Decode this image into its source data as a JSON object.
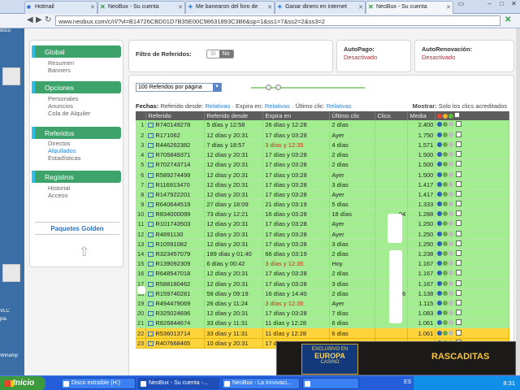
{
  "tabs": [
    {
      "label": "Hotmail",
      "icon": "hotmail-icon"
    },
    {
      "label": "NeoBux - Su cuenta",
      "icon": "neobux-icon"
    },
    {
      "label": "Me banearon del foro de",
      "icon": "forum-icon"
    },
    {
      "label": "Ganar dinero en internet",
      "icon": "forum-icon"
    },
    {
      "label": "NeoBux - Su cuenta",
      "icon": "neobux-icon"
    }
  ],
  "address": "www.neobux.com/c/rl/?vl=B14726CBD01D7B35E00C98631893C3B6&sp=1&ss1=7&ss2=2&ss3=2",
  "desktop": [
    "docu",
    "VLC",
    "pla",
    "Winamp"
  ],
  "menu": {
    "global": {
      "title": "Global",
      "items": [
        "Resumen",
        "Banners"
      ]
    },
    "opciones": {
      "title": "Opciones",
      "items": [
        "Personales",
        "Anuncios",
        "Cola de Alquiler"
      ]
    },
    "referidos": {
      "title": "Referidos",
      "items": [
        "Directos",
        "Alquilados",
        "Estadísticas"
      ]
    },
    "registros": {
      "title": "Registros",
      "items": [
        "Historial",
        "Acceso"
      ]
    },
    "golden": "Paquetes Golden"
  },
  "filter": {
    "label": "Filtro de Referidos:",
    "yes": "Sí",
    "no": "No"
  },
  "autopago": {
    "label": "AutoPago:",
    "value": "Desactivado"
  },
  "autorenov": {
    "label": "AutoRenovación:",
    "value": "Desactivado"
  },
  "per_page": "100 Referidos por página",
  "fechas": {
    "prefix": "Fechas:",
    "since_label": "Referido desde:",
    "since_link": "Relativas",
    "expires_label": "· Expira en:",
    "expires_link": "Relativas",
    "lastclick_label": "· Último clic:",
    "lastclick_link": "Relativas",
    "mostrar_label": "Mostrar:",
    "mostrar_value": "Solo los clics acreditados"
  },
  "columns": [
    "Referido",
    "Referido desde",
    "Expira en",
    "Último clic",
    "Clics",
    "Media"
  ],
  "rows": [
    {
      "n": "1",
      "id": "R740149278",
      "since": "5 días y 12:58",
      "exp": "26 días y 12:28",
      "last": "2 días",
      "clicks": "",
      "avg": "2.400",
      "red": false
    },
    {
      "n": "2",
      "id": "R171062",
      "since": "12 días y 20:31",
      "exp": "17 días y 03:28",
      "last": "Ayer",
      "clicks": "",
      "avg": "1.750",
      "red": false
    },
    {
      "n": "3",
      "id": "R446262382",
      "since": "7 días y 18:57",
      "exp": "3 días y 12:35",
      "last": "4 días",
      "clicks": "",
      "avg": "1.571",
      "red": true
    },
    {
      "n": "4",
      "id": "R705849371",
      "since": "12 días y 20:31",
      "exp": "17 días y 03:28",
      "last": "2 días",
      "clicks": "",
      "avg": "1.500",
      "red": false
    },
    {
      "n": "5",
      "id": "R702743714",
      "since": "12 días y 20:31",
      "exp": "17 días y 03:28",
      "last": "2 días",
      "clicks": "",
      "avg": "1.500",
      "red": false
    },
    {
      "n": "6",
      "id": "R589274499",
      "since": "12 días y 20:31",
      "exp": "17 días y 03:28",
      "last": "Ayer",
      "clicks": "",
      "avg": "1.500",
      "red": false
    },
    {
      "n": "7",
      "id": "R116913470",
      "since": "12 días y 20:31",
      "exp": "17 días y 03:28",
      "last": "3 días",
      "clicks": "",
      "avg": "1.417",
      "red": false
    },
    {
      "n": "8",
      "id": "R147922201",
      "since": "12 días y 20:31",
      "exp": "17 días y 03:28",
      "last": "Ayer",
      "clicks": "",
      "avg": "1.417",
      "red": false
    },
    {
      "n": "9",
      "id": "R640644519",
      "since": "27 días y 18:09",
      "exp": "21 días y 03:19",
      "last": "5 días",
      "clicks": "",
      "avg": "1.333",
      "red": false
    },
    {
      "n": "10",
      "id": "R834000099",
      "since": "73 días y 12:21",
      "exp": "16 días y 03:28",
      "last": "18 días",
      "clicks": "94",
      "avg": "1.288",
      "red": false
    },
    {
      "n": "11",
      "id": "R101743503",
      "since": "12 días y 20:31",
      "exp": "17 días y 03:28",
      "last": "Ayer",
      "clicks": "",
      "avg": "1.250",
      "red": false
    },
    {
      "n": "12",
      "id": "R4891130",
      "since": "12 días y 20:31",
      "exp": "17 días y 03:28",
      "last": "Ayer",
      "clicks": "",
      "avg": "1.250",
      "red": false
    },
    {
      "n": "13",
      "id": "R10591082",
      "since": "12 días y 20:31",
      "exp": "17 días y 03:28",
      "last": "3 días",
      "clicks": "",
      "avg": "1.250",
      "red": false
    },
    {
      "n": "14",
      "id": "R323457079",
      "since": "189 días y 01:40",
      "exp": "66 días y 03:19",
      "last": "2 días",
      "clicks": "",
      "avg": "1.238",
      "red": false
    },
    {
      "n": "15",
      "id": "R139092309",
      "since": "6 días y 00:42",
      "exp": "3 días y 12:35",
      "last": "Hoy",
      "clicks": "",
      "avg": "1.167",
      "red": true
    },
    {
      "n": "16",
      "id": "R648547018",
      "since": "12 días y 20:31",
      "exp": "17 días y 03:28",
      "last": "2 días",
      "clicks": "",
      "avg": "1.167",
      "red": false
    },
    {
      "n": "17",
      "id": "R588180462",
      "since": "12 días y 20:31",
      "exp": "17 días y 03:28",
      "last": "3 días",
      "clicks": "",
      "avg": "1.167",
      "red": false
    },
    {
      "n": "18",
      "id": "R159740281",
      "since": "58 días y 09:19",
      "exp": "16 días y 14:40",
      "last": "2 días",
      "clicks": "66",
      "avg": "1.138",
      "red": false
    },
    {
      "n": "19",
      "id": "R494479069",
      "since": "26 días y 11:24",
      "exp": "3 días y 12:35",
      "last": "Ayer",
      "clicks": "",
      "avg": "1.115",
      "red": true
    },
    {
      "n": "20",
      "id": "R325024696",
      "since": "12 días y 20:31",
      "exp": "17 días y 03:28",
      "last": "7 días",
      "clicks": "",
      "avg": "1.083",
      "red": false
    },
    {
      "n": "21",
      "id": "R826844674",
      "since": "33 días y 11:31",
      "exp": "11 días y 12:28",
      "last": "6 días",
      "clicks": "",
      "avg": "1.061",
      "red": false
    },
    {
      "n": "22",
      "id": "R536013714",
      "since": "33 días y 11:31",
      "exp": "11 días y 12:28",
      "last": "6 días",
      "clicks": "",
      "avg": "1.061",
      "red": false
    },
    {
      "n": "23",
      "id": "R407668465",
      "since": "10 días y 20:31",
      "exp": "17 días y 03:28",
      "last": "Ayer",
      "clicks": "",
      "avg": "1.000",
      "red": false
    }
  ],
  "ad": {
    "casino_line1": "EXCLUSIVO EN",
    "casino_line2": "EUROPA",
    "casino_line3": "CASINO",
    "right": "RASCADITAS"
  },
  "taskbar": {
    "start": "Inicio",
    "buttons": [
      "Disco extraíble (H:)",
      "NeoBux - Su cuenta -...",
      "NeoBux - La Innovaci...",
      ""
    ],
    "lang": "ES",
    "clock": "8:31"
  }
}
